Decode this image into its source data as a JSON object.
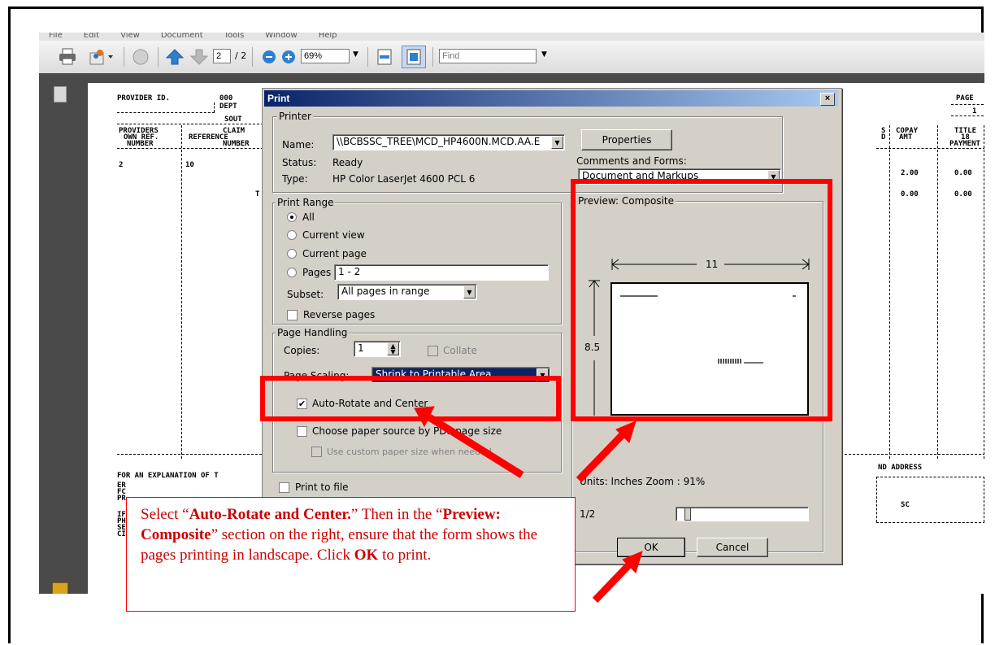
{
  "menubar": [
    "File",
    "Edit",
    "View",
    "Document",
    "Tools",
    "Window",
    "Help"
  ],
  "toolbar": {
    "page_current": "2",
    "page_total": "/ 2",
    "zoom": "69%",
    "find_placeholder": "Find"
  },
  "document": {
    "provider_id": "PROVIDER ID.",
    "id_value": "000",
    "dept": "DEPT",
    "sout": "SOUT",
    "page_label": "PAGE",
    "page_value": "1",
    "col_providers": "PROVIDERS",
    "col_own_ref": "OWN REF.",
    "col_number": "NUMBER",
    "col_claim": "CLAIM",
    "col_reference": "REFERENCE",
    "col_number2": "NUMBER",
    "col_copay": "COPAY",
    "col_amt": "AMT",
    "col_title": "TITLE",
    "col_18": "18",
    "col_payment": "PAYMENT",
    "row1_a": "2",
    "row1_b": "10",
    "row1_copay": "2.00",
    "row1_title": "0.00",
    "row2_t": "T",
    "row2_copay": "0.00",
    "row2_title": "0.00",
    "nd_address": "ND ADDRESS",
    "for_explanation": "FOR AN EXPLANATION OF T",
    "sc": "SC"
  },
  "dialog": {
    "title": "Print",
    "close": "×",
    "printer_group": "Printer",
    "name_label": "Name:",
    "name_value": "\\\\BCBSSC_TREE\\MCD_HP4600N.MCD.AA.E",
    "status_label": "Status:",
    "status_value": "Ready",
    "type_label": "Type:",
    "type_value": "HP Color LaserJet 4600 PCL 6",
    "properties_button": "Properties",
    "comments_label": "Comments and Forms:",
    "comments_value": "Document and Markups",
    "print_range_group": "Print Range",
    "all": "All",
    "current_view": "Current view",
    "current_page": "Current page",
    "pages": "Pages",
    "pages_value": "1 - 2",
    "subset_label": "Subset:",
    "subset_value": "All pages in range",
    "reverse_pages": "Reverse pages",
    "page_handling_group": "Page Handling",
    "copies_label": "Copies:",
    "copies_value": "1",
    "collate": "Collate",
    "page_scaling_label": "Page Scaling:",
    "page_scaling_value": "Shrink to Printable Area",
    "auto_rotate": "Auto-Rotate and Center",
    "choose_paper": "Choose paper source by PDF page size",
    "custom_paper": "Use custom paper size when needed",
    "print_to_file": "Print to file",
    "preview_group": "Preview: Composite",
    "preview_width": "11",
    "preview_height": "8.5",
    "units_zoom": "Units: Inches Zoom : 91%",
    "page_count": "1/2",
    "ok_button": "OK",
    "cancel_button": "Cancel"
  },
  "callout": {
    "p1": "Select “",
    "b1": "Auto-Rotate and Center.",
    "p2": "” Then in the “",
    "b2": "Preview: Composite",
    "p3": "” section on the right, ensure that the form shows the pages printing in landscape.  Click ",
    "b3": "OK",
    "p4": " to print."
  },
  "colors": {
    "highlight": "#ff0000",
    "titlebar": "#0a246a",
    "dialog_bg": "#d4d0c8"
  }
}
